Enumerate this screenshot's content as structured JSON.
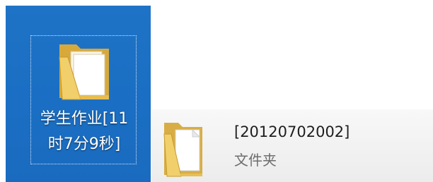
{
  "desktop": {
    "selected_item": {
      "icon": "folder-icon",
      "label_line1": "学生作业[11",
      "label_line2": "时7分9秒]"
    }
  },
  "explorer_tile": {
    "icon": "folder-icon",
    "name": "[20120702002]",
    "type": "文件夹"
  }
}
